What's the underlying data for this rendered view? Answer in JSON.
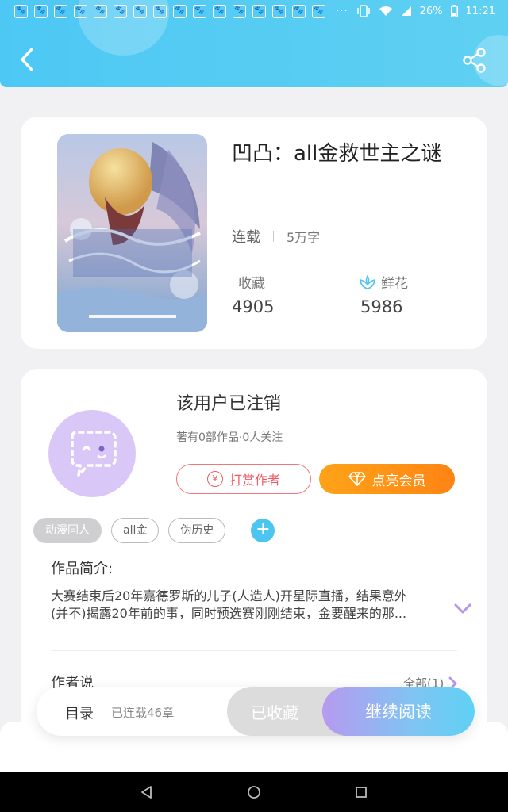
{
  "status_bar": {
    "notifications": [
      "🐾",
      "🐾",
      "🐾",
      "🐾",
      "🐾",
      "🐾",
      "🐾",
      "🐾",
      "🐾",
      "🐾",
      "🐾",
      "🐾",
      "🐾",
      "🐾",
      "🐾",
      "🐾"
    ],
    "dots": "···",
    "battery": "26%",
    "time": "11:21"
  },
  "header": {
    "back_icon": "chevron-left-icon",
    "share_icon": "share-icon"
  },
  "book": {
    "title": "凹凸：all金救世主之谜",
    "status": "连载",
    "word_count": "5万字",
    "favorites_label": "收藏",
    "favorites_value": "4905",
    "flowers_label": "鲜花",
    "flowers_value": "5986"
  },
  "author": {
    "name": "该用户已注销",
    "stats": "著有0部作品·0人关注",
    "reward_label": "打赏作者",
    "reward_icon_text": "¥",
    "vip_label": "点亮会员"
  },
  "tags": [
    "动漫同人",
    "all金",
    "伪历史"
  ],
  "tag_add": "+",
  "intro": {
    "title": "作品简介:",
    "line1": "大赛结束后20年嘉德罗斯的儿子(人造人)开星际直播，结果意外",
    "line2": "(并不)揭露20年前的事，同时预选赛刚刚结束，金要醒来的那..."
  },
  "author_says": {
    "title": "作者说",
    "all_link": "全部(1)"
  },
  "bottom_bar": {
    "toc_label": "目录",
    "toc_count": "已连载46章",
    "favorited_label": "已收藏",
    "continue_label": "继续阅读"
  },
  "colors": {
    "header": "#4dc8f4",
    "reward": "#ef5b63",
    "vip": "#ff9016",
    "accent_blue": "#4cc6f0",
    "avatar": "#d9c8f7"
  }
}
